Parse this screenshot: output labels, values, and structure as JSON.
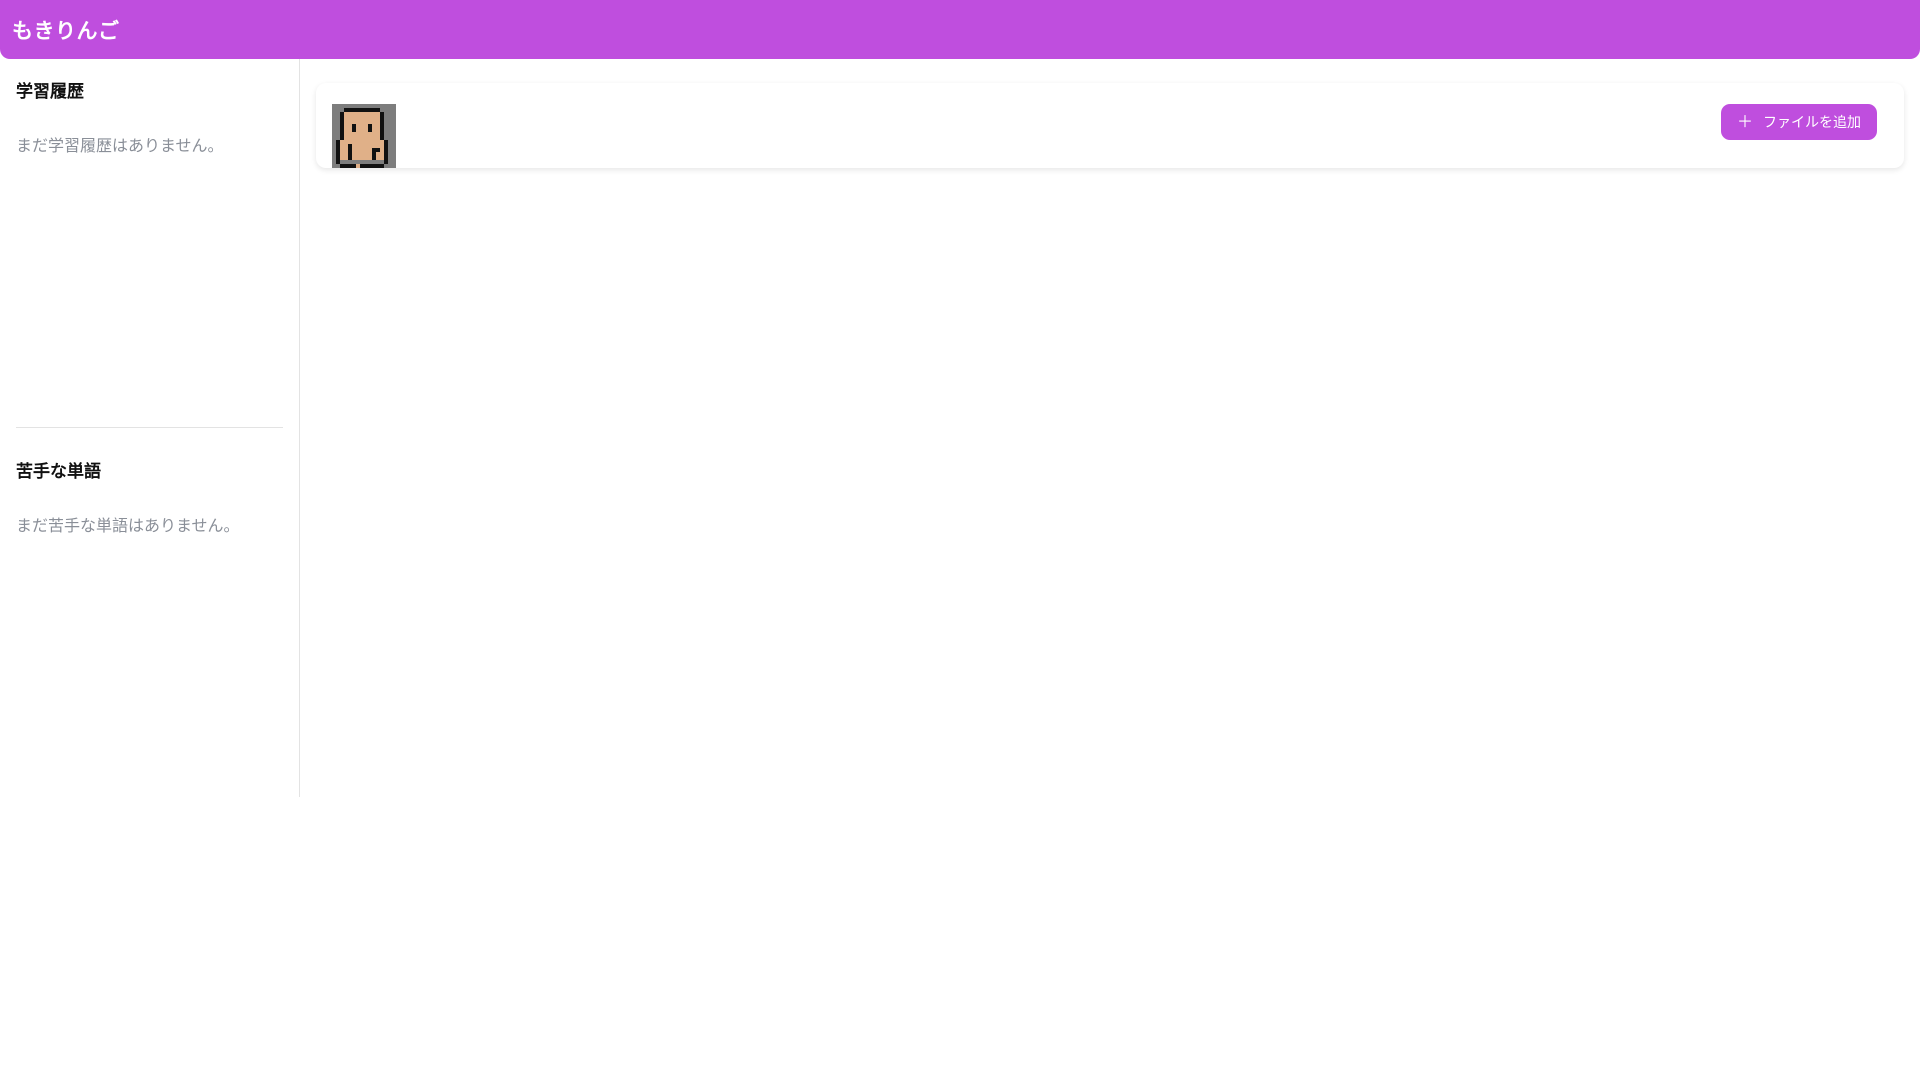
{
  "header": {
    "title": "もきりんご"
  },
  "sidebar": {
    "history": {
      "heading": "学習履歴",
      "empty_text": "まだ学習履歴はありません。"
    },
    "weak_words": {
      "heading": "苦手な単語",
      "empty_text": "まだ苦手な単語はありません。"
    }
  },
  "main": {
    "avatar_icon": "pixel-character-icon",
    "add_file_button": {
      "icon": "plus-icon",
      "label": "ファイルを追加"
    }
  },
  "colors": {
    "accent": "#bf4ede",
    "muted_text": "#8a8f98",
    "avatar_bg": "#7d7d7d",
    "avatar_skin": "#e0b088"
  }
}
